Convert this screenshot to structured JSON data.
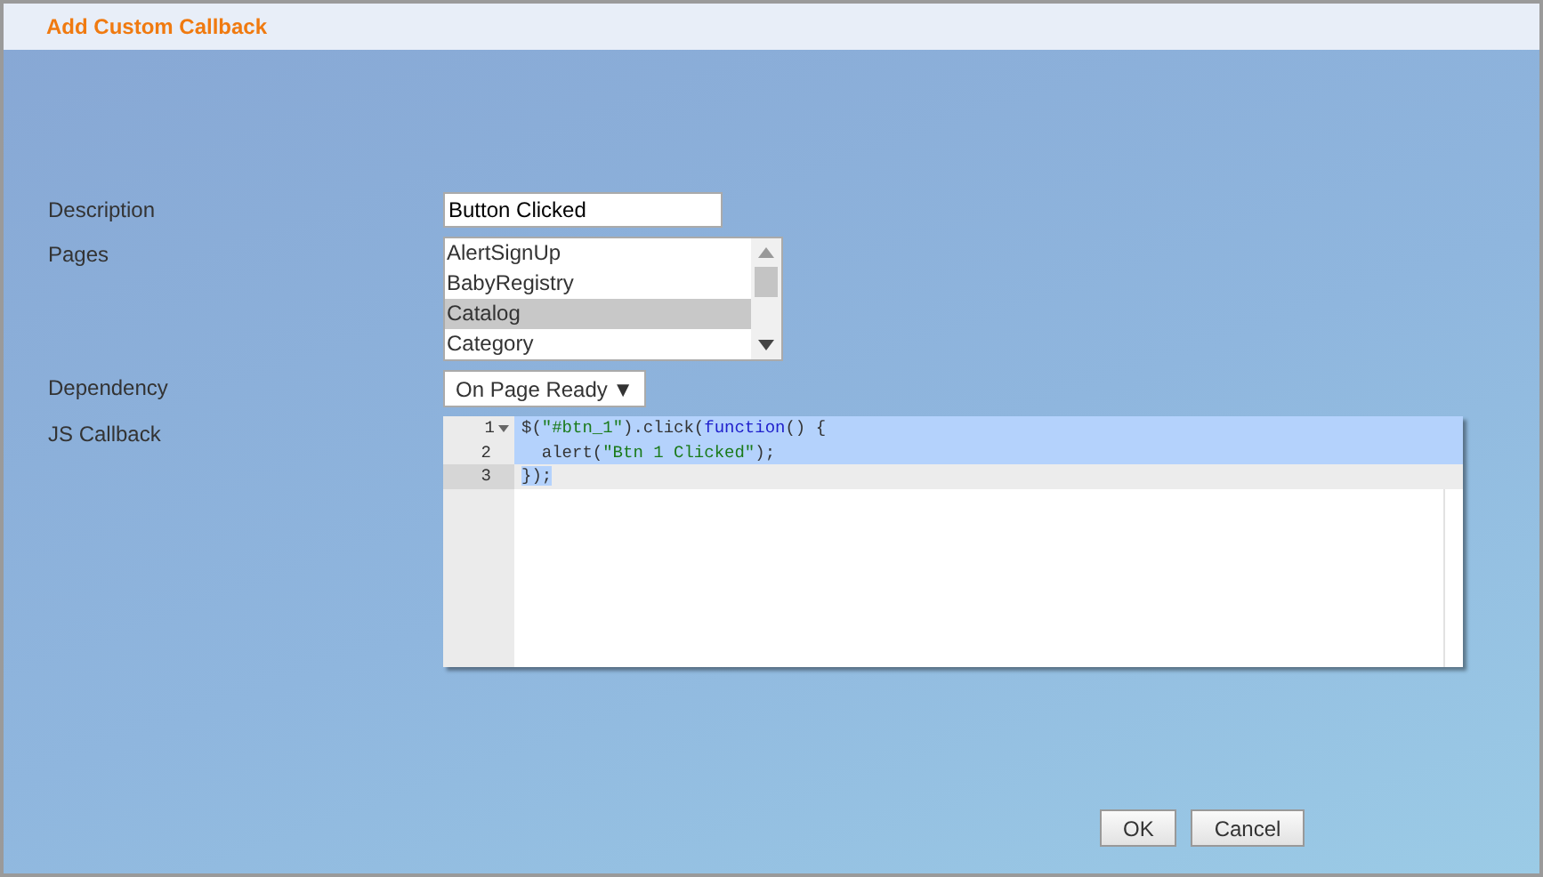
{
  "dialog": {
    "title": "Add Custom Callback"
  },
  "form": {
    "description": {
      "label": "Description",
      "value": "Button Clicked"
    },
    "pages": {
      "label": "Pages",
      "items": [
        {
          "label": "AlertSignUp",
          "selected": false
        },
        {
          "label": "BabyRegistry",
          "selected": false
        },
        {
          "label": "Catalog",
          "selected": true
        },
        {
          "label": "Category",
          "selected": false
        }
      ]
    },
    "dependency": {
      "label": "Dependency",
      "value": "On Page Ready",
      "arrow": "▼"
    },
    "callback": {
      "label": "JS Callback",
      "lines": [
        {
          "number": "1",
          "foldable": true,
          "selected": true,
          "active": false,
          "tokens": [
            {
              "kind": "plain",
              "text": "$("
            },
            {
              "kind": "string",
              "text": "\"#btn_1\""
            },
            {
              "kind": "plain",
              "text": ").click("
            },
            {
              "kind": "keyword",
              "text": "function"
            },
            {
              "kind": "plain",
              "text": "() {"
            }
          ]
        },
        {
          "number": "2",
          "foldable": false,
          "selected": true,
          "active": false,
          "tokens": [
            {
              "kind": "plain",
              "text": "  alert("
            },
            {
              "kind": "string",
              "text": "\"Btn 1 Clicked\""
            },
            {
              "kind": "plain",
              "text": ");"
            }
          ]
        },
        {
          "number": "3",
          "foldable": false,
          "selected": true,
          "active": true,
          "tokens": [
            {
              "kind": "plain",
              "text": "});"
            }
          ]
        }
      ]
    }
  },
  "buttons": [
    {
      "label": "OK"
    },
    {
      "label": "Cancel"
    }
  ]
}
